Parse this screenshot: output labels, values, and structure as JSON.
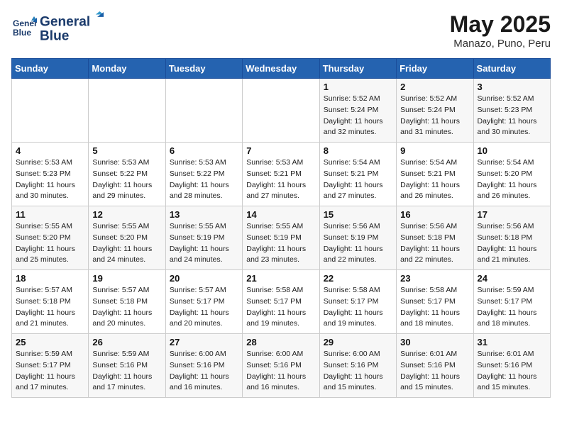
{
  "header": {
    "logo_line1": "General",
    "logo_line2": "Blue",
    "month": "May 2025",
    "location": "Manazo, Puno, Peru"
  },
  "weekdays": [
    "Sunday",
    "Monday",
    "Tuesday",
    "Wednesday",
    "Thursday",
    "Friday",
    "Saturday"
  ],
  "weeks": [
    [
      {
        "day": "",
        "info": ""
      },
      {
        "day": "",
        "info": ""
      },
      {
        "day": "",
        "info": ""
      },
      {
        "day": "",
        "info": ""
      },
      {
        "day": "1",
        "info": "Sunrise: 5:52 AM\nSunset: 5:24 PM\nDaylight: 11 hours\nand 32 minutes."
      },
      {
        "day": "2",
        "info": "Sunrise: 5:52 AM\nSunset: 5:24 PM\nDaylight: 11 hours\nand 31 minutes."
      },
      {
        "day": "3",
        "info": "Sunrise: 5:52 AM\nSunset: 5:23 PM\nDaylight: 11 hours\nand 30 minutes."
      }
    ],
    [
      {
        "day": "4",
        "info": "Sunrise: 5:53 AM\nSunset: 5:23 PM\nDaylight: 11 hours\nand 30 minutes."
      },
      {
        "day": "5",
        "info": "Sunrise: 5:53 AM\nSunset: 5:22 PM\nDaylight: 11 hours\nand 29 minutes."
      },
      {
        "day": "6",
        "info": "Sunrise: 5:53 AM\nSunset: 5:22 PM\nDaylight: 11 hours\nand 28 minutes."
      },
      {
        "day": "7",
        "info": "Sunrise: 5:53 AM\nSunset: 5:21 PM\nDaylight: 11 hours\nand 27 minutes."
      },
      {
        "day": "8",
        "info": "Sunrise: 5:54 AM\nSunset: 5:21 PM\nDaylight: 11 hours\nand 27 minutes."
      },
      {
        "day": "9",
        "info": "Sunrise: 5:54 AM\nSunset: 5:21 PM\nDaylight: 11 hours\nand 26 minutes."
      },
      {
        "day": "10",
        "info": "Sunrise: 5:54 AM\nSunset: 5:20 PM\nDaylight: 11 hours\nand 26 minutes."
      }
    ],
    [
      {
        "day": "11",
        "info": "Sunrise: 5:55 AM\nSunset: 5:20 PM\nDaylight: 11 hours\nand 25 minutes."
      },
      {
        "day": "12",
        "info": "Sunrise: 5:55 AM\nSunset: 5:20 PM\nDaylight: 11 hours\nand 24 minutes."
      },
      {
        "day": "13",
        "info": "Sunrise: 5:55 AM\nSunset: 5:19 PM\nDaylight: 11 hours\nand 24 minutes."
      },
      {
        "day": "14",
        "info": "Sunrise: 5:55 AM\nSunset: 5:19 PM\nDaylight: 11 hours\nand 23 minutes."
      },
      {
        "day": "15",
        "info": "Sunrise: 5:56 AM\nSunset: 5:19 PM\nDaylight: 11 hours\nand 22 minutes."
      },
      {
        "day": "16",
        "info": "Sunrise: 5:56 AM\nSunset: 5:18 PM\nDaylight: 11 hours\nand 22 minutes."
      },
      {
        "day": "17",
        "info": "Sunrise: 5:56 AM\nSunset: 5:18 PM\nDaylight: 11 hours\nand 21 minutes."
      }
    ],
    [
      {
        "day": "18",
        "info": "Sunrise: 5:57 AM\nSunset: 5:18 PM\nDaylight: 11 hours\nand 21 minutes."
      },
      {
        "day": "19",
        "info": "Sunrise: 5:57 AM\nSunset: 5:18 PM\nDaylight: 11 hours\nand 20 minutes."
      },
      {
        "day": "20",
        "info": "Sunrise: 5:57 AM\nSunset: 5:17 PM\nDaylight: 11 hours\nand 20 minutes."
      },
      {
        "day": "21",
        "info": "Sunrise: 5:58 AM\nSunset: 5:17 PM\nDaylight: 11 hours\nand 19 minutes."
      },
      {
        "day": "22",
        "info": "Sunrise: 5:58 AM\nSunset: 5:17 PM\nDaylight: 11 hours\nand 19 minutes."
      },
      {
        "day": "23",
        "info": "Sunrise: 5:58 AM\nSunset: 5:17 PM\nDaylight: 11 hours\nand 18 minutes."
      },
      {
        "day": "24",
        "info": "Sunrise: 5:59 AM\nSunset: 5:17 PM\nDaylight: 11 hours\nand 18 minutes."
      }
    ],
    [
      {
        "day": "25",
        "info": "Sunrise: 5:59 AM\nSunset: 5:17 PM\nDaylight: 11 hours\nand 17 minutes."
      },
      {
        "day": "26",
        "info": "Sunrise: 5:59 AM\nSunset: 5:16 PM\nDaylight: 11 hours\nand 17 minutes."
      },
      {
        "day": "27",
        "info": "Sunrise: 6:00 AM\nSunset: 5:16 PM\nDaylight: 11 hours\nand 16 minutes."
      },
      {
        "day": "28",
        "info": "Sunrise: 6:00 AM\nSunset: 5:16 PM\nDaylight: 11 hours\nand 16 minutes."
      },
      {
        "day": "29",
        "info": "Sunrise: 6:00 AM\nSunset: 5:16 PM\nDaylight: 11 hours\nand 15 minutes."
      },
      {
        "day": "30",
        "info": "Sunrise: 6:01 AM\nSunset: 5:16 PM\nDaylight: 11 hours\nand 15 minutes."
      },
      {
        "day": "31",
        "info": "Sunrise: 6:01 AM\nSunset: 5:16 PM\nDaylight: 11 hours\nand 15 minutes."
      }
    ]
  ]
}
